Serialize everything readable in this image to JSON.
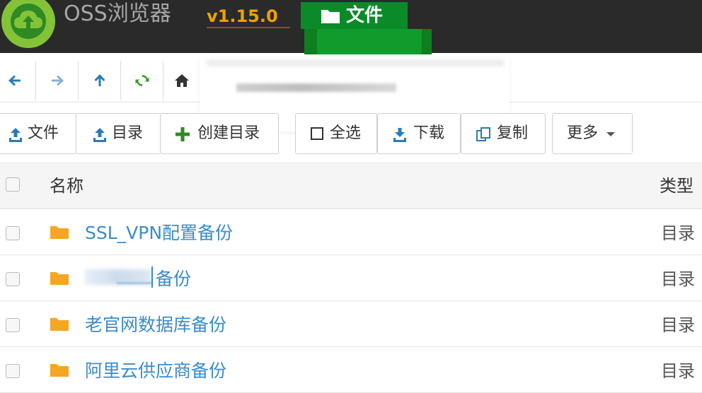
{
  "app": {
    "name": "OSS浏览器",
    "version": "v1.15.0",
    "active_tab": "文件"
  },
  "nav": {
    "back_icon": "arrow-left-icon",
    "forward_icon": "arrow-right-icon",
    "up_icon": "arrow-up-icon",
    "refresh_icon": "refresh-icon",
    "home_icon": "home-icon"
  },
  "toolbar": {
    "upload_file_label": "文件",
    "upload_dir_label": "目录",
    "create_dir_label": "创建目录",
    "select_all_label": "全选",
    "download_label": "下载",
    "copy_label": "复制",
    "more_label": "更多"
  },
  "table": {
    "columns": {
      "name": "名称",
      "type": "类型"
    },
    "rows": [
      {
        "name": "SSL_VPN配置备份",
        "type": "目录"
      },
      {
        "name": "备份",
        "type": "目录"
      },
      {
        "name": "老官网数据库备份",
        "type": "目录"
      },
      {
        "name": "阿里云供应商备份",
        "type": "目录"
      }
    ]
  },
  "colors": {
    "header_bg": "#2a2a2a",
    "version": "#f0a000",
    "tab_active": "#0b8a2a",
    "link": "#3a8bcd",
    "folder": "#f5a623",
    "nav_icon": "#2a7ab9",
    "refresh_icon": "#3c9a2c"
  }
}
